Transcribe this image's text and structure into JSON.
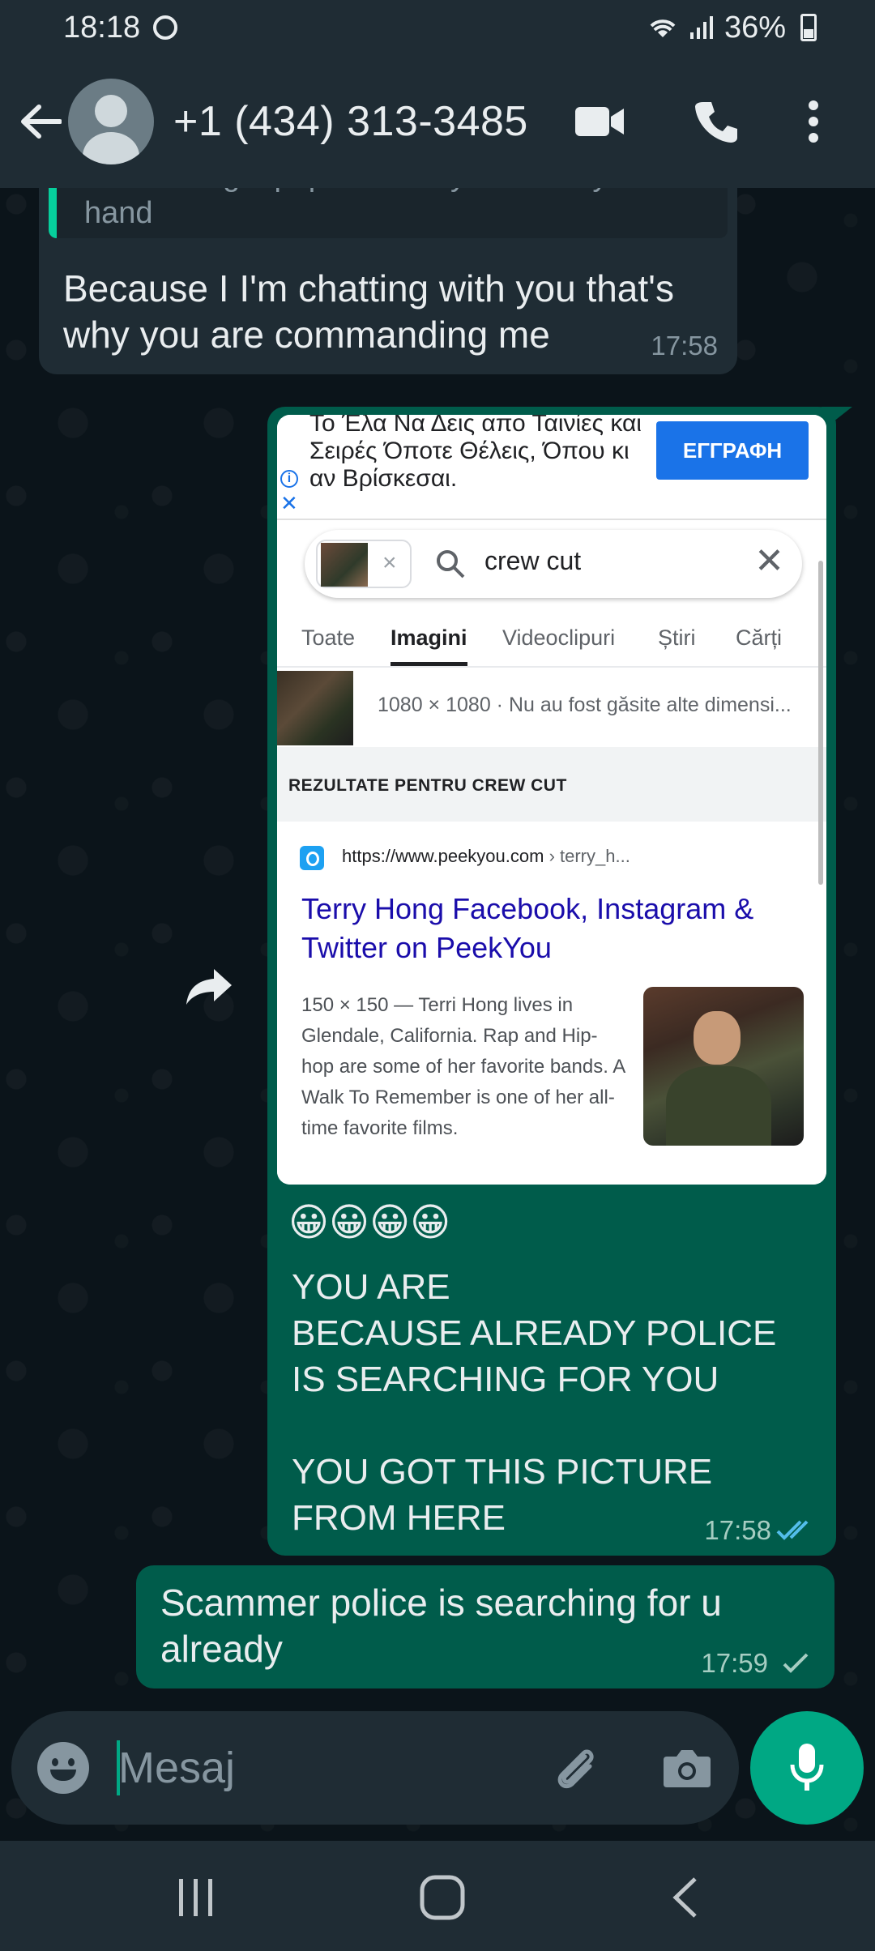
{
  "status_bar": {
    "time": "18:18",
    "battery": "36%"
  },
  "header": {
    "contact_name": "+1 (434) 313-3485"
  },
  "messages": {
    "incoming": {
      "quoted_text": "now having a paper with my name in your hand",
      "text": "Because I I'm chatting with you that's why you are commanding me",
      "time": "17:58"
    },
    "outgoing_image": {
      "ad_text": "Το Έλα Να Δεις απο Ταινίες και Σειρές Όποτε Θέλεις, Όπου κι αν Βρίσκεσαι.",
      "ad_button": "ΕΓΓΡΑΦΗ",
      "search_query": "crew cut",
      "tabs": [
        "Toate",
        "Imagini",
        "Videoclipuri",
        "Știri",
        "Cărți"
      ],
      "active_tab": "Imagini",
      "size_info": "1080 × 1080 · Nu au fost găsite alte dimensi...",
      "results_header": "REZULTATE PENTRU CREW CUT",
      "result_url": "https://www.peekyou.com",
      "result_crumb": " › terry_h...",
      "result_title": "Terry Hong Facebook, Instagram & Twitter on PeekYou",
      "result_snippet": "150 × 150 — Terri Hong lives in Glendale, California. Rap and Hip-hop are some of her favorite bands. A Walk To Remember is one of her all-time favorite films.",
      "caption_emoji": "😀😀😀😀",
      "caption": "YOU ARE\nBECAUSE ALREADY POLICE IS SEARCHING FOR YOU\n\nYOU GOT THIS PICTURE FROM HERE",
      "time": "17:58",
      "receipt": "read"
    },
    "outgoing_text": {
      "text": "Scammer police is searching for u already",
      "time": "17:59",
      "receipt": "sent"
    }
  },
  "composer": {
    "placeholder": "Mesaj"
  },
  "colors": {
    "background": "#0b141a",
    "header": "#1f2c34",
    "incoming_bubble": "#1f2c34",
    "outgoing_bubble": "#005c4b",
    "accent": "#00a884",
    "read_tick": "#53bdeb"
  },
  "icons": [
    "back-arrow-icon",
    "video-call-icon",
    "voice-call-icon",
    "more-options-icon",
    "forward-icon",
    "emoji-icon",
    "attach-icon",
    "camera-icon",
    "mic-icon"
  ]
}
